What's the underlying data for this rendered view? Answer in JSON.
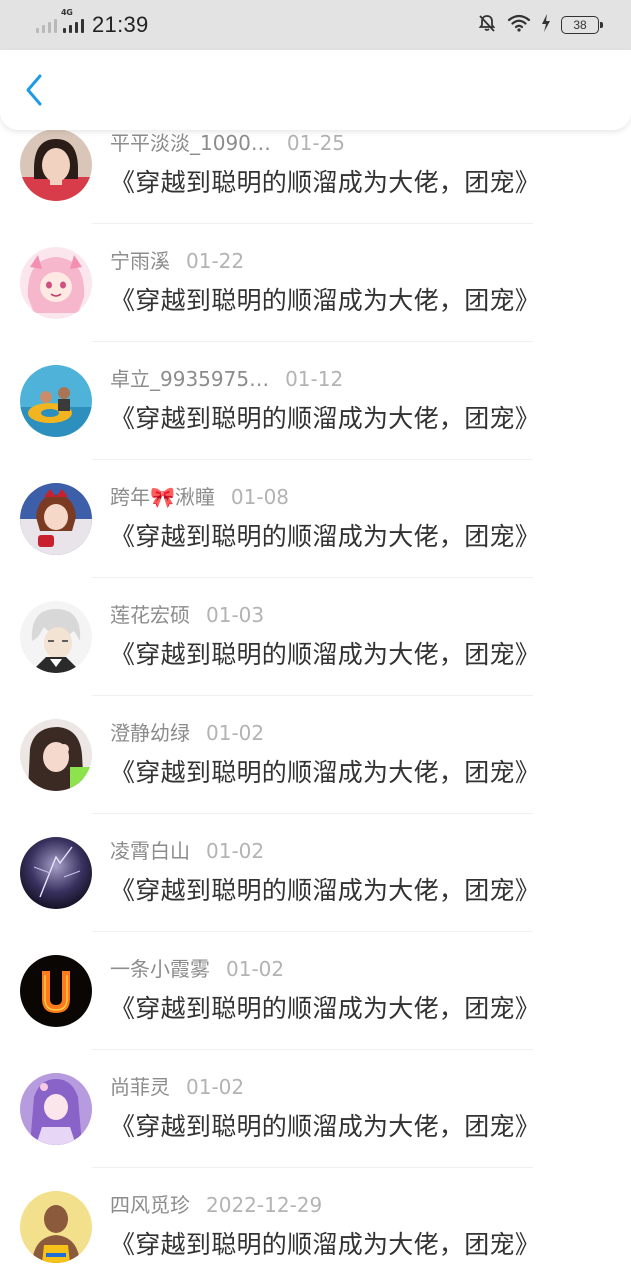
{
  "status_bar": {
    "network": "4G",
    "time": "21:39",
    "battery": "38"
  },
  "header": {
    "back_icon": "chevron-left-icon",
    "accent": "#1e9be8"
  },
  "items": [
    {
      "username": "平平淡淡_1090…",
      "date": "01-25",
      "text": "《穿越到聪明的顺溜成为大佬，团宠》"
    },
    {
      "username": "宁雨溪",
      "date": "01-22",
      "text": "《穿越到聪明的顺溜成为大佬，团宠》"
    },
    {
      "username": "卓立_9935975…",
      "date": "01-12",
      "text": "《穿越到聪明的顺溜成为大佬，团宠》"
    },
    {
      "username": "跨年🎀湫瞳",
      "date": "01-08",
      "text": "《穿越到聪明的顺溜成为大佬，团宠》"
    },
    {
      "username": "莲花宏硕",
      "date": "01-03",
      "text": "《穿越到聪明的顺溜成为大佬，团宠》"
    },
    {
      "username": "澄静幼绿",
      "date": "01-02",
      "text": "《穿越到聪明的顺溜成为大佬，团宠》"
    },
    {
      "username": "凌霄白山",
      "date": "01-02",
      "text": "《穿越到聪明的顺溜成为大佬，团宠》"
    },
    {
      "username": "一条小霞雾",
      "date": "01-02",
      "text": "《穿越到聪明的顺溜成为大佬，团宠》"
    },
    {
      "username": "尚菲灵",
      "date": "01-02",
      "text": "《穿越到聪明的顺溜成为大佬，团宠》"
    },
    {
      "username": "四风觅珍",
      "date": "2022-12-29",
      "text": "《穿越到聪明的顺溜成为大佬，团宠》"
    }
  ]
}
